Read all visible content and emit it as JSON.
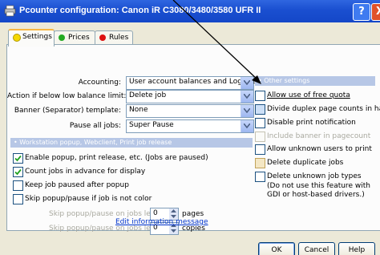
{
  "window": {
    "title": "Pcounter configuration: Canon iR C3080/3480/3580 UFR II",
    "help_glyph": "?",
    "close_glyph": "X"
  },
  "tabs": [
    {
      "label": "Settings",
      "dot_color": "#f5d800"
    },
    {
      "label": "Prices",
      "dot_color": "#22aa22"
    },
    {
      "label": "Rules",
      "dot_color": "#dd1111"
    }
  ],
  "form": {
    "accounting": {
      "label": "Accounting:",
      "value": "User account balances and Log File"
    },
    "low_balance": {
      "label": "Action if below low balance limit:",
      "value": "Delete job"
    },
    "banner": {
      "label": "Banner (Separator) template:",
      "value": "None"
    },
    "pause": {
      "label": "Pause all jobs:",
      "value": "Super Pause"
    }
  },
  "popup_section": {
    "title": "Workstation popup, Webclient, Print job release",
    "checkboxes": [
      {
        "label": "Enable popup, print release, etc. (Jobs are paused)",
        "checked": true
      },
      {
        "label": "Count jobs in advance for display",
        "checked": true
      },
      {
        "label": "Keep job paused after popup",
        "checked": false
      },
      {
        "label": "Skip popup/pause if job is not color",
        "checked": false
      }
    ],
    "skip_pages": {
      "label": "Skip popup/pause on jobs less than",
      "value": "0",
      "unit": "pages"
    },
    "skip_copies": {
      "label": "Skip popup/pause on jobs less than",
      "value": "0",
      "unit": "copies"
    },
    "edit_link": "Edit information message"
  },
  "other_section": {
    "title": "Other settings",
    "checkboxes": [
      {
        "label": "Allow use of free quota",
        "checked": false,
        "disabled": false
      },
      {
        "label": "Divide duplex page counts in half",
        "checked": false,
        "disabled": false
      },
      {
        "label": "Disable print notification",
        "checked": false,
        "disabled": false
      },
      {
        "label": "Include banner in pagecount",
        "checked": false,
        "disabled": true
      },
      {
        "label": "Allow unknown users to print",
        "checked": false,
        "disabled": false
      },
      {
        "label": "Delete duplicate jobs",
        "checked": false,
        "disabled": false
      },
      {
        "label": "Delete unknown job types",
        "checked": false,
        "disabled": false
      }
    ],
    "note_line1": "(Do not use this feature with",
    "note_line2": "GDI or host-based drivers.)"
  },
  "buttons": {
    "ok": "OK",
    "cancel": "Cancel",
    "help": "Help"
  },
  "colors": {
    "title_bar": "#1a4fd0",
    "section_header": "#b7c7e6",
    "arrow": "#000000"
  }
}
